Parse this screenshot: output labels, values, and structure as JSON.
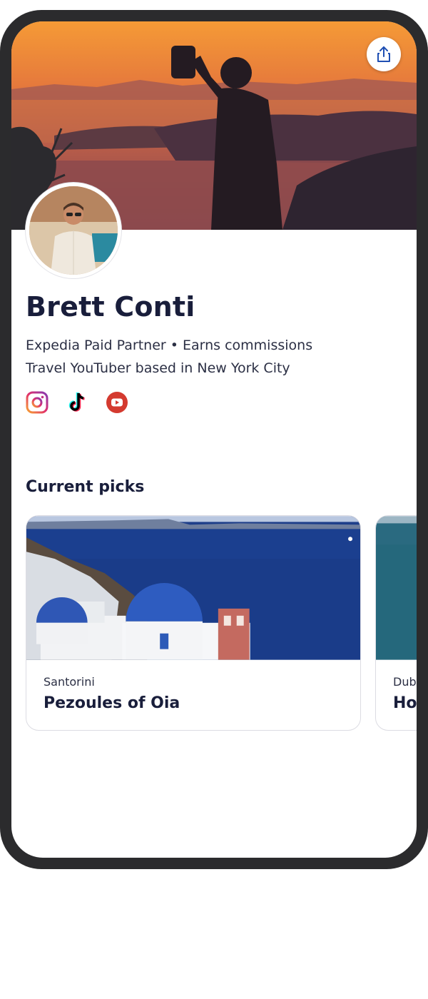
{
  "profile": {
    "name": "Brett Conti",
    "partner_line": "Expedia Paid Partner • Earns commissions",
    "bio": "Travel YouTuber based in New York City"
  },
  "header": {
    "share_icon": "share-icon"
  },
  "socials": [
    {
      "name": "instagram-icon",
      "color": "#d6249f"
    },
    {
      "name": "tiktok-icon",
      "color": "#000000"
    },
    {
      "name": "youtube-icon",
      "color": "#d43a2f"
    }
  ],
  "picks": {
    "title": "Current picks",
    "items": [
      {
        "location": "Santorini",
        "title": "Pezoules of Oia"
      },
      {
        "location": "Dub",
        "title": "Ho"
      }
    ]
  },
  "colors": {
    "text_dark": "#191e3b",
    "phone_frame": "#2b2b2d"
  }
}
